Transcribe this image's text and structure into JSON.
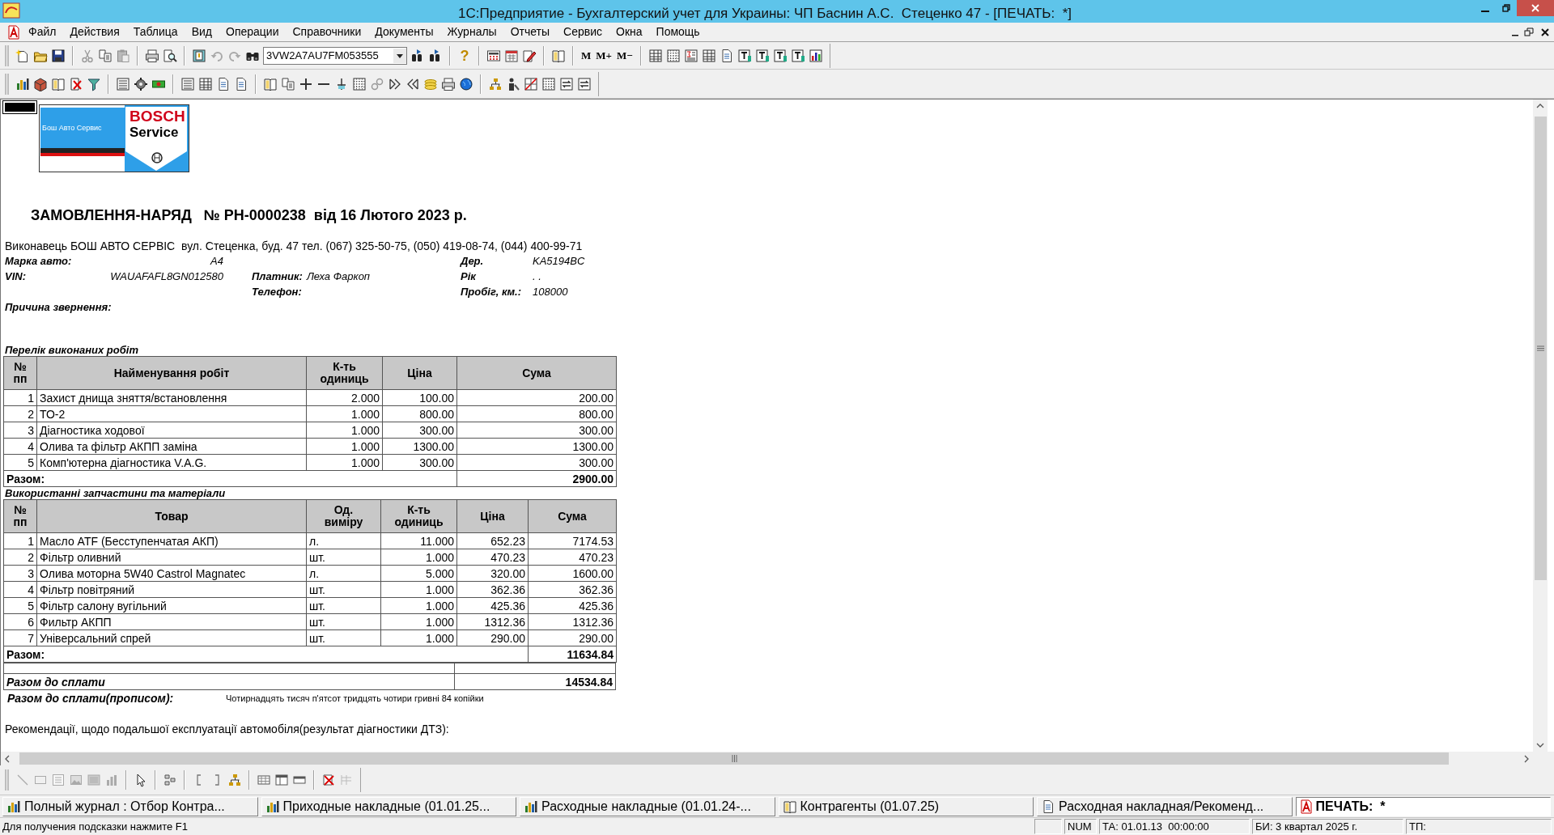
{
  "window": {
    "title": "1С:Предприятие - Бухгалтерский учет для Украины: ЧП Баснин А.С.  Стеценко 47 - [ПЕЧАТЬ:  *]"
  },
  "menu": [
    "Файл",
    "Действия",
    "Таблица",
    "Вид",
    "Операции",
    "Справочники",
    "Документы",
    "Журналы",
    "Отчеты",
    "Сервис",
    "Окна",
    "Помощь"
  ],
  "toolbar": {
    "combo_value": "3VW2A7AU7FM053555",
    "help": "?",
    "memory_buttons": [
      "M",
      "M+",
      "M−"
    ]
  },
  "document": {
    "logo": {
      "caption": "Бош Авто Сервис",
      "brand": "BOSCH",
      "subtitle": "Service"
    },
    "title": "ЗАМОВЛЕННЯ-НАРЯД   № РН-0000238  від 16 Лютого 2023 р.",
    "contractor": "Виконавець БОШ АВТО СЕРВІС  вул. Стеценка, буд. 47 тел. (067) 325-50-75, (050) 419-08-74, (044) 400-99-71",
    "info_rows": [
      [
        {
          "label": "Марка авто:",
          "value": "А4"
        },
        null,
        {
          "label": "Дер.",
          "value": "KA5194BC"
        }
      ],
      [
        {
          "label": "VIN:",
          "value": "WAUAFAFL8GN012580"
        },
        {
          "label": "Платник:",
          "value": "Леха Фаркоп"
        },
        {
          "label": "Рік",
          "value": ". ."
        }
      ],
      [
        null,
        {
          "label": "Телефон:"
        },
        {
          "label": "Пробіг, км.:",
          "value": "108000"
        }
      ],
      [
        {
          "label": "Причина звернення:"
        },
        null,
        null
      ]
    ],
    "works": {
      "section_title": "Перелік виконаних робіт",
      "columns": [
        "№ пп",
        "Найменування робіт",
        "К-ть одиниць",
        "Ціна",
        "Сума"
      ],
      "rows": [
        [
          "1",
          "Захист днища зняття/встановлення",
          "2.000",
          "100.00",
          "200.00"
        ],
        [
          "2",
          "ТО-2",
          "1.000",
          "800.00",
          "800.00"
        ],
        [
          "3",
          "Діагностика ходової",
          "1.000",
          "300.00",
          "300.00"
        ],
        [
          "4",
          "Олива та фільтр АКПП заміна",
          "1.000",
          "1300.00",
          "1300.00"
        ],
        [
          "5",
          "Комп'ютерна діагностика V.A.G.",
          "1.000",
          "300.00",
          "300.00"
        ]
      ],
      "total": {
        "label": "Разом:",
        "value": "2900.00"
      }
    },
    "parts": {
      "section_title": "Використанні запчастини та матеріали",
      "columns": [
        "№ пп",
        "Товар",
        "Од. виміру",
        "К-ть одиниць",
        "Ціна",
        "Сума"
      ],
      "rows": [
        [
          "1",
          "Масло ATF (Бесступенчатая АКП)",
          "л.",
          "11.000",
          "652.23",
          "7174.53"
        ],
        [
          "2",
          "Фільтр оливний",
          "шт.",
          "1.000",
          "470.23",
          "470.23"
        ],
        [
          "3",
          "Олива моторна 5W40 Castrol Magnatec",
          "л.",
          "5.000",
          "320.00",
          "1600.00"
        ],
        [
          "4",
          "Фільтр повітряний",
          "шт.",
          "1.000",
          "362.36",
          "362.36"
        ],
        [
          "5",
          "Фільтр салону вугільний",
          "шт.",
          "1.000",
          "425.36",
          "425.36"
        ],
        [
          "6",
          "Фильтр АКПП",
          "шт.",
          "1.000",
          "1312.36",
          "1312.36"
        ],
        [
          "7",
          "Універсальний спрей",
          "шт.",
          "1.000",
          "290.00",
          "290.00"
        ]
      ],
      "total": {
        "label": "Разом:",
        "value": "11634.84"
      }
    },
    "grand_total": {
      "label": "Разом до сплати",
      "value": "14534.84"
    },
    "in_words": {
      "label": "Разом до сплати(прописом):",
      "value": "Чотирнадцять тисяч п'ятсот тридцять чотири гривні 84 копійки"
    },
    "recommendations": "Рекомендації, щодо подальшої експлуатації автомобіля(результат діагностики ДТЗ):"
  },
  "windows": [
    {
      "kind": "journal",
      "label": "Полный журнал : Отбор Контра...",
      "selected": false
    },
    {
      "kind": "journal",
      "label": "Приходные накладные (01.01.25...",
      "selected": false
    },
    {
      "kind": "journal",
      "label": "Расходные накладные (01.01.24-...",
      "selected": false
    },
    {
      "kind": "catalog",
      "label": "Контрагенты (01.07.25)",
      "selected": false
    },
    {
      "kind": "document",
      "label": "Расходная накладная/Рекоменд...",
      "selected": false
    },
    {
      "kind": "print",
      "label": "ПЕЧАТЬ:  *",
      "selected": true
    }
  ],
  "status_bar": {
    "hint": "Для получения подсказки нажмите F1",
    "panels": [
      "NUM",
      "ТА: 01.01.13  00:00:00",
      "БИ: 3 квартал 2025 г.",
      "ТП:"
    ]
  }
}
